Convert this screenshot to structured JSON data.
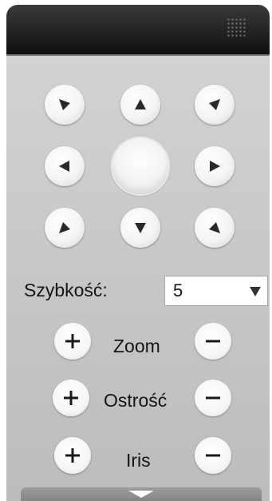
{
  "ptz": {
    "speed_label": "Szybkość:",
    "speed_value": "5",
    "zoom_label": "Zoom",
    "focus_label": "Ostrość",
    "iris_label": "Iris"
  },
  "icons": {
    "up_left": "triangle-down-right-icon",
    "up": "triangle-up-icon",
    "up_right": "triangle-down-left-icon",
    "left": "triangle-left-icon",
    "right": "triangle-right-icon",
    "down_left": "triangle-up-right-icon",
    "down": "triangle-down-icon",
    "down_right": "triangle-up-left-icon",
    "plus": "plus-icon",
    "minus": "minus-icon",
    "collapse": "chevron-down-icon"
  },
  "colors": {
    "panel_bg": "#c4c4c4",
    "titlebar": "#111111",
    "arrow": "#2a2a2a"
  }
}
